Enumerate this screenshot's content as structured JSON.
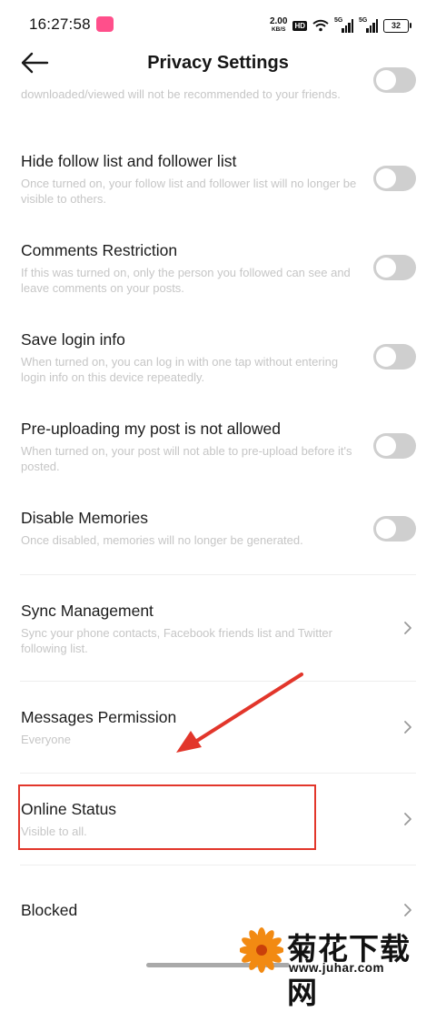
{
  "status_bar": {
    "time": "16:27:58",
    "net_speed_value": "2.00",
    "net_speed_unit": "KB/S",
    "hd_label": "HD",
    "network_1": "5G",
    "network_2": "5G",
    "battery": "32"
  },
  "header": {
    "title": "Privacy Settings"
  },
  "items": [
    {
      "title": "",
      "desc": "downloaded/viewed will not be recommended to your friends.",
      "control": "toggle",
      "on": false
    },
    {
      "title": "Hide follow list and follower list",
      "desc": "Once turned on, your follow list and follower list will no longer be visible to others.",
      "control": "toggle",
      "on": false
    },
    {
      "title": "Comments Restriction",
      "desc": "If this was turned on, only the person you followed can see and leave comments on your posts.",
      "control": "toggle",
      "on": false
    },
    {
      "title": "Save login info",
      "desc": "When turned on, you can log in with one tap without entering login info on this device repeatedly.",
      "control": "toggle",
      "on": false
    },
    {
      "title": "Pre-uploading my post is not allowed",
      "desc": "When turned on, your post will not able to pre-upload before it's posted.",
      "control": "toggle",
      "on": false
    },
    {
      "title": "Disable Memories",
      "desc": "Once disabled, memories will no longer be generated.",
      "control": "toggle",
      "on": false
    },
    {
      "title": "Sync Management",
      "desc": "Sync your phone contacts, Facebook friends list and Twitter following list.",
      "control": "chevron"
    },
    {
      "title": "Messages Permission",
      "desc": "Everyone",
      "control": "chevron"
    },
    {
      "title": "Online Status",
      "desc": "Visible to all.",
      "control": "chevron"
    },
    {
      "title": "Blocked",
      "desc": "",
      "control": "chevron"
    }
  ],
  "watermark": {
    "chinese": "菊花下载网",
    "url": "www.juhar.com"
  },
  "colors": {
    "toggle_off": "#cfcfcf",
    "annotation_red": "#e2362b",
    "desc_text": "#c6c6c6"
  }
}
